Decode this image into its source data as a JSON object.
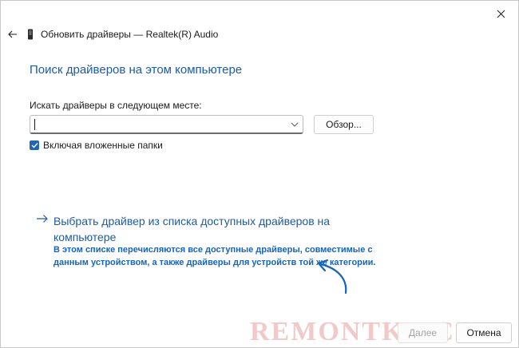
{
  "window": {
    "title": "Обновить драйверы — Realtek(R) Audio",
    "close_icon": "close-icon",
    "back_icon": "back-arrow-icon",
    "device_icon": "device-icon"
  },
  "main": {
    "heading": "Поиск драйверов на этом компьютере",
    "path_label": "Искать драйверы в следующем месте:",
    "path_value": "",
    "browse_label": "Обзор...",
    "include_subfolders": {
      "label": "Включая вложенные папки",
      "checked": true
    },
    "option": {
      "title": "Выбрать драйвер из списка доступных драйверов на компьютере",
      "description": "В этом списке перечисляются все доступные драйверы, совместимые с данным устройством, а также драйверы для устройств той же категории."
    }
  },
  "footer": {
    "next_label": "Далее",
    "cancel_label": "Отмена"
  },
  "watermark": "REMONTKA.COM",
  "colors": {
    "accent": "#1a5ca8",
    "checkbox": "#1f67b5",
    "watermark": "#f2c9c9"
  }
}
